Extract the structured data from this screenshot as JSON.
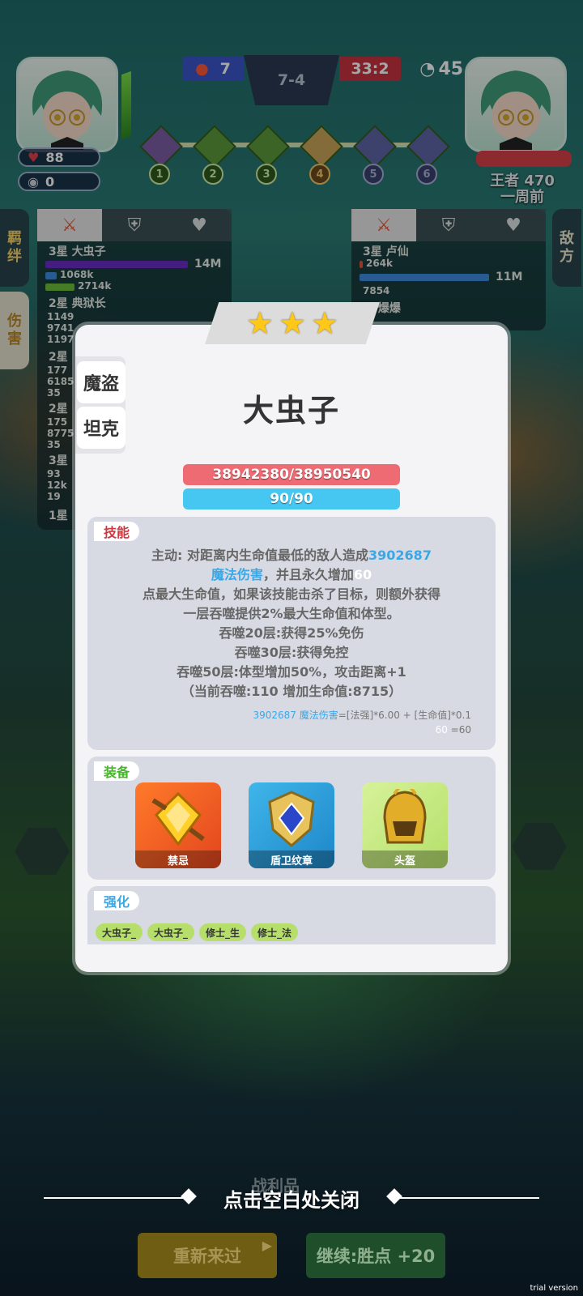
{
  "hud": {
    "fire_score": "7",
    "stage": "7-4",
    "kill_ratio": "33:2",
    "timer": "45.2",
    "my_hp": "88",
    "my_coins": "0",
    "stages": [
      "1",
      "2",
      "3",
      "4",
      "5",
      "6"
    ],
    "enemy_name": "王者 470",
    "enemy_time": "一周前"
  },
  "side_tabs": {
    "left_top": [
      "羁",
      "绊"
    ],
    "left_bottom": [
      "伤",
      "害"
    ],
    "right_top": [
      "敌",
      "方"
    ]
  },
  "left_panel": {
    "rows": [
      {
        "label": "3星 大虫子",
        "bar_value": "14M",
        "sub1": "1068k",
        "sub2": "2714k"
      },
      {
        "label": "2星 典狱长",
        "nums": [
          "1149",
          "9741",
          "1197"
        ]
      },
      {
        "label": "2星",
        "nums": [
          "177",
          "6185",
          "35"
        ]
      },
      {
        "label": "2星",
        "nums": [
          "175",
          "8775",
          "35"
        ]
      },
      {
        "label": "3星",
        "nums": [
          "93",
          "12k",
          "19"
        ]
      },
      {
        "label": "1星"
      }
    ]
  },
  "right_panel": {
    "rows": [
      {
        "label": "3星 卢仙",
        "sub1": "264k",
        "bar_value": "11M",
        "sub2": "7854"
      },
      {
        "label": "星 爆爆"
      }
    ]
  },
  "modal": {
    "stars": 3,
    "traits": [
      "魔盗",
      "坦克"
    ],
    "hero_name": "大虫子",
    "hp_text": "38942380/38950540",
    "mana_text": "90/90",
    "skill_tag": "技能",
    "skill": {
      "l1a": "主动: 对距离内生命值最低的敌人造成",
      "l1b": "3902687",
      "l2a": "魔法伤害",
      "l2b": "，并且永久增加",
      "l2c": "60",
      "l3": "点最大生命值，如果该技能击杀了目标，则额外获得",
      "l4": "一层吞噬提供2%最大生命值和体型。",
      "l5": "吞噬20层:获得25%免伤",
      "l6": "吞噬30层:获得免控",
      "l7": "吞噬50层:体型增加50%，攻击距离+1",
      "l8": "（当前吞噬:110 增加生命值:8715）"
    },
    "formula": {
      "f1a": "3902687 魔法伤害",
      "f1b": "=[法强]*6.00 + [生命值]*0.1",
      "f2a": "60",
      "f2b": " =60"
    },
    "equip_tag": "装备",
    "equipment": [
      "禁忌",
      "盾卫纹章",
      "头盔"
    ],
    "enhance_tag": "强化",
    "enhancements": [
      "大虫子_",
      "大虫子_",
      "修士_生",
      "修士_法"
    ]
  },
  "bottom": {
    "close_hint": "点击空白处关闭",
    "spoils_label": "战利品",
    "retry_label": "重新来过",
    "continue_label": "继续:胜点 +20",
    "trial": "trial version"
  },
  "colors": {
    "hp_bar": "#ef6b73",
    "mana_bar": "#45c7f2",
    "accent_blue": "#3aa8e6",
    "retry_btn": "#b99a1f",
    "continue_btn": "#2f7a3a"
  }
}
